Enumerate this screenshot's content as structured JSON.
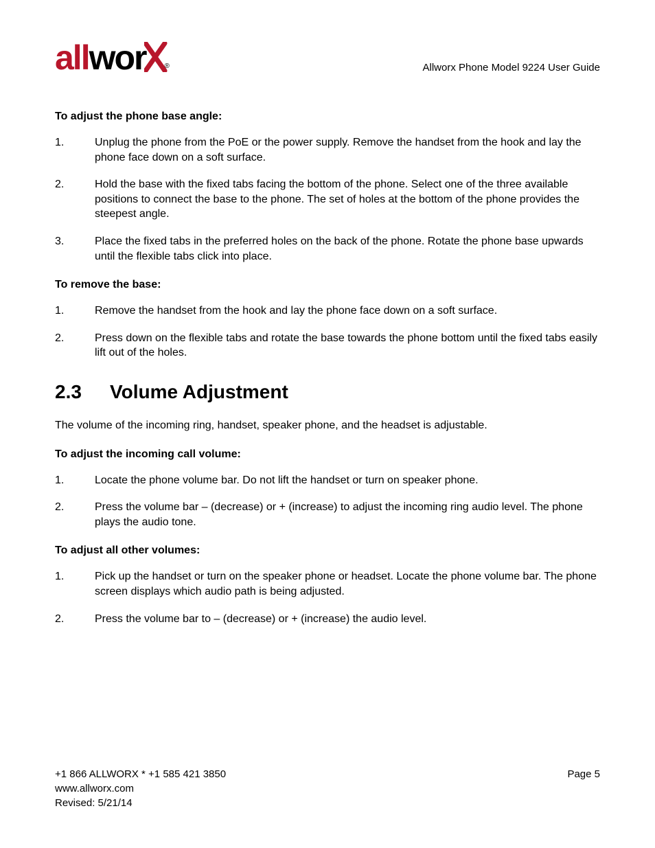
{
  "header": {
    "logo_part1": "all",
    "logo_part2": "wor",
    "reg": "®",
    "doc_title": "Allworx Phone Model 9224 User Guide"
  },
  "sec1": {
    "heading": "To adjust the phone base angle:",
    "items": [
      {
        "n": "1.",
        "t": "Unplug the phone from the PoE or the power supply. Remove the handset from the hook and lay the phone face down on a soft surface."
      },
      {
        "n": "2.",
        "t": "Hold the base with the fixed tabs facing the bottom of the phone. Select one of the three available positions to connect the base to the phone. The set of holes at the bottom of the phone provides the steepest angle."
      },
      {
        "n": "3.",
        "t": "Place the fixed tabs in the preferred holes on the back of the phone. Rotate the phone base upwards until the flexible tabs click into place."
      }
    ]
  },
  "sec2": {
    "heading": "To remove the base:",
    "items": [
      {
        "n": "1.",
        "t": "Remove the handset from the hook and lay the phone face down on a soft surface."
      },
      {
        "n": "2.",
        "t": "Press down on the flexible tabs and rotate the base towards the phone bottom until the fixed tabs easily lift out of the holes."
      }
    ]
  },
  "section_heading": {
    "num": "2.3",
    "title": "Volume Adjustment"
  },
  "intro": "The volume of the incoming ring, handset, speaker phone, and the headset is adjustable.",
  "sec3": {
    "heading": "To adjust the incoming call volume:",
    "items": [
      {
        "n": "1.",
        "t": "Locate the phone volume bar. Do not lift the handset or turn on speaker phone."
      },
      {
        "n": "2.",
        "t": "Press the volume bar – (decrease) or + (increase) to adjust the incoming ring audio level. The phone plays the audio tone."
      }
    ]
  },
  "sec4": {
    "heading": "To adjust all other volumes:",
    "items": [
      {
        "n": "1.",
        "t": "Pick up the handset or turn on the speaker phone or headset. Locate the phone volume bar. The phone screen displays which audio path is being adjusted."
      },
      {
        "n": "2.",
        "t": "Press the volume bar to – (decrease) or + (increase) the audio level."
      }
    ]
  },
  "footer": {
    "contact": "+1 866 ALLWORX * +1 585 421 3850",
    "page": "Page 5",
    "url": "www.allworx.com",
    "revised": "Revised: 5/21/14"
  }
}
